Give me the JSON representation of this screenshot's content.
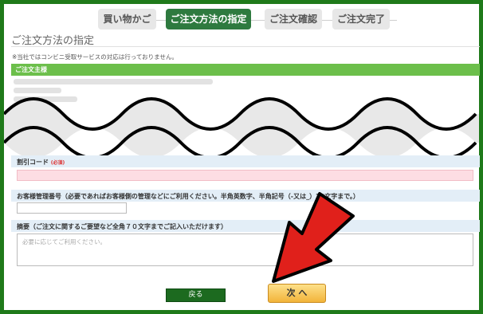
{
  "steps": [
    {
      "label": "買い物かご",
      "active": false
    },
    {
      "label": "ご注文方法の指定",
      "active": true
    },
    {
      "label": "ご注文確認",
      "active": false
    },
    {
      "label": "ご注文完了",
      "active": false
    }
  ],
  "page_title": "ご注文方法の指定",
  "notice": "※当社ではコンビニ受取サービスの対応は行っておりません。",
  "orderer_section": "ご注文主様",
  "discount_code": {
    "label": "割引コード",
    "required": "(必須)"
  },
  "customer_mgmt": {
    "label": "お客様管理番号（必要であればお客様側の管理などにご利用ください。半角英数字、半角記号（-又は_）20文字まで。）"
  },
  "notes": {
    "label": "摘要（ご注文に関するご要望など全角７０文字までご記入いただけます）",
    "placeholder": "必要に応じてご利用ください。"
  },
  "buttons": {
    "back": "戻る",
    "next": "次 へ"
  },
  "colors": {
    "frame": "#1f7a1a",
    "active_step": "#2e7a3f",
    "section_bar": "#6cbf4b",
    "arrow": "#e0201b"
  }
}
